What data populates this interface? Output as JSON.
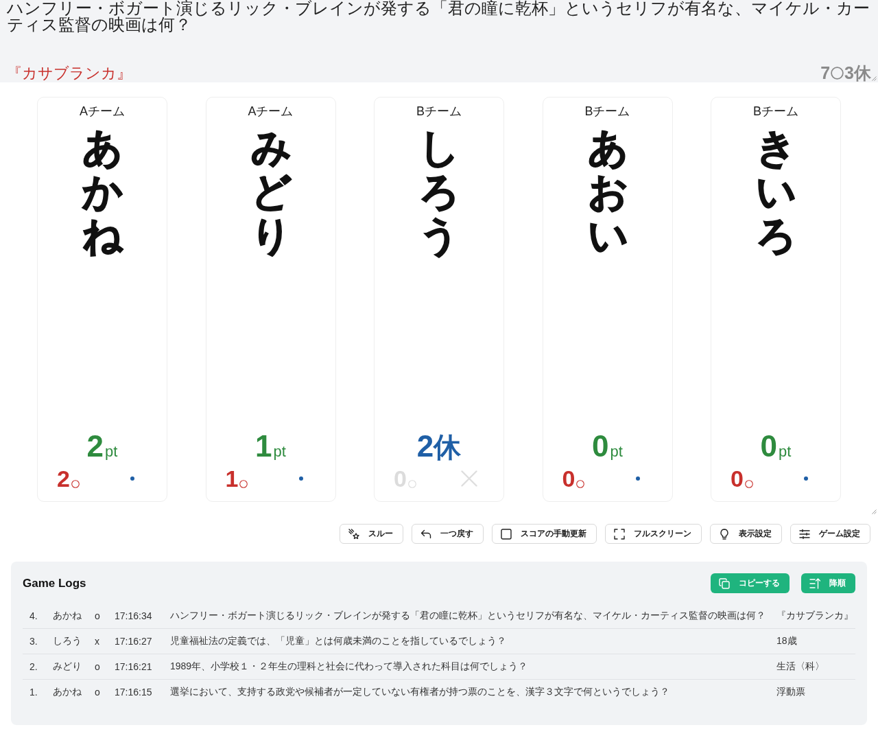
{
  "question": {
    "text": "ハンフリー・ボガート演じるリック・ブレインが発する「君の瞳に乾杯」というセリフが有名な、マイケル・カーティス監督の映画は何？",
    "answer": "『カサブランカ』",
    "correct_total": "7",
    "rest_total": "3休"
  },
  "players": [
    {
      "kind": "active",
      "team": "Aチーム",
      "name": "あかね",
      "score": "2",
      "unit": "pt",
      "correct": "2"
    },
    {
      "kind": "active",
      "team": "Aチーム",
      "name": "みどり",
      "score": "1",
      "unit": "pt",
      "correct": "1"
    },
    {
      "kind": "resting",
      "team": "Bチーム",
      "name": "しろう",
      "score": "2",
      "unit": "休",
      "correct": "0"
    },
    {
      "kind": "active",
      "team": "Bチーム",
      "name": "あおい",
      "score": "0",
      "unit": "pt",
      "correct": "0"
    },
    {
      "kind": "active",
      "team": "Bチーム",
      "name": "きいろ",
      "score": "0",
      "unit": "pt",
      "correct": "0"
    }
  ],
  "toolbar": [
    {
      "kind": "skip",
      "label": "スルー"
    },
    {
      "kind": "undo",
      "label": "一つ戻す"
    },
    {
      "kind": "manual_update",
      "label": "スコアの手動更新"
    },
    {
      "kind": "fullscreen",
      "label": "フルスクリーン"
    },
    {
      "kind": "display_settings",
      "label": "表示設定"
    },
    {
      "kind": "game_settings",
      "label": "ゲーム設定"
    }
  ],
  "game_logs": {
    "title": "Game Logs",
    "buttons": [
      {
        "kind": "copy",
        "label": "コピーする"
      },
      {
        "kind": "sort",
        "label": "降順"
      }
    ],
    "rows": [
      {
        "number": "4.",
        "player": "あかね",
        "result": "o",
        "time": "17:16:34",
        "question": "ハンフリー・ボガート演じるリック・ブレインが発する「君の瞳に乾杯」というセリフが有名な、マイケル・カーティス監督の映画は何？",
        "answer": "『カサブランカ』"
      },
      {
        "number": "3.",
        "player": "しろう",
        "result": "x",
        "time": "17:16:27",
        "question": "児童福祉法の定義では、「児童」とは何歳未満のことを指しているでしょう？",
        "answer": "18歳"
      },
      {
        "number": "2.",
        "player": "みどり",
        "result": "o",
        "time": "17:16:21",
        "question": "1989年、小学校１・２年生の理科と社会に代わって導入された科目は何でしょう？",
        "answer": "生活〈科〉"
      },
      {
        "number": "1.",
        "player": "あかね",
        "result": "o",
        "time": "17:16:15",
        "question": "選挙において、支持する政党や候補者が一定していない有権者が持つ票のことを、漢字３文字で何というでしょう？",
        "answer": "浮動票"
      }
    ]
  }
}
